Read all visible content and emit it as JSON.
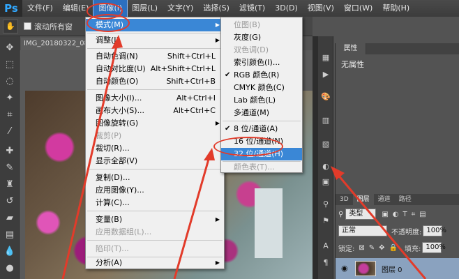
{
  "app": {
    "logo": "Ps"
  },
  "menubar": [
    {
      "label": "文件(F)"
    },
    {
      "label": "编辑(E)"
    },
    {
      "label": "图像(I)",
      "active": true
    },
    {
      "label": "图层(L)"
    },
    {
      "label": "文字(Y)"
    },
    {
      "label": "选择(S)"
    },
    {
      "label": "滤镜(T)"
    },
    {
      "label": "3D(D)"
    },
    {
      "label": "视图(V)"
    },
    {
      "label": "窗口(W)"
    },
    {
      "label": "帮助(H)"
    }
  ],
  "options_bar": {
    "scroll_all_label": "滚动所有窗"
  },
  "document": {
    "tab_title": "IMG_20180322_08"
  },
  "image_menu": {
    "items": [
      {
        "label": "模式(M)",
        "shortcut": "",
        "submenu": true,
        "highlighted": true
      },
      {
        "label": "调整(J)",
        "shortcut": "",
        "submenu": true
      },
      {
        "label": "自动色调(N)",
        "shortcut": "Shift+Ctrl+L"
      },
      {
        "label": "自动对比度(U)",
        "shortcut": "Alt+Shift+Ctrl+L"
      },
      {
        "label": "自动颜色(O)",
        "shortcut": "Shift+Ctrl+B"
      },
      {
        "label": "图像大小(I)...",
        "shortcut": "Alt+Ctrl+I"
      },
      {
        "label": "画布大小(S)...",
        "shortcut": "Alt+Ctrl+C"
      },
      {
        "label": "图像旋转(G)",
        "shortcut": "",
        "submenu": true
      },
      {
        "label": "裁剪(P)",
        "shortcut": "",
        "disabled": true
      },
      {
        "label": "裁切(R)...",
        "shortcut": ""
      },
      {
        "label": "显示全部(V)",
        "shortcut": ""
      },
      {
        "label": "复制(D)...",
        "shortcut": ""
      },
      {
        "label": "应用图像(Y)...",
        "shortcut": ""
      },
      {
        "label": "计算(C)...",
        "shortcut": ""
      },
      {
        "label": "变量(B)",
        "shortcut": "",
        "submenu": true
      },
      {
        "label": "应用数据组(L)...",
        "shortcut": "",
        "disabled": true
      },
      {
        "label": "陷印(T)...",
        "shortcut": "",
        "disabled": true
      },
      {
        "label": "分析(A)",
        "shortcut": "",
        "submenu": true
      }
    ]
  },
  "mode_menu": {
    "items": [
      {
        "label": "位图(B)",
        "disabled": true
      },
      {
        "label": "灰度(G)"
      },
      {
        "label": "双色调(D)",
        "disabled": true
      },
      {
        "label": "索引颜色(I)..."
      },
      {
        "label": "RGB 颜色(R)",
        "checked": true
      },
      {
        "label": "CMYK 颜色(C)"
      },
      {
        "label": "Lab 颜色(L)"
      },
      {
        "label": "多通道(M)"
      },
      {
        "label": "8 位/通道(A)",
        "checked": true
      },
      {
        "label": "16 位/通道(N)"
      },
      {
        "label": "32 位/通道(H)",
        "highlighted": true
      },
      {
        "label": "颜色表(T)...",
        "disabled": true
      }
    ]
  },
  "properties_panel": {
    "tab_label": "属性",
    "content": "无属性"
  },
  "layers_panel": {
    "tabs": [
      "3D",
      "图层",
      "通道",
      "路径"
    ],
    "filter_label": "类型",
    "blend_mode": "正常",
    "opacity_label": "不透明度:",
    "opacity_value": "100%",
    "lock_label": "锁定:",
    "fill_label": "填充:",
    "fill_value": "100%",
    "layer_name": "图层 0"
  },
  "colors": {
    "highlight": "#3a87d6",
    "annotation_red": "#e23b2a",
    "menubar": "#3c3c3c"
  }
}
